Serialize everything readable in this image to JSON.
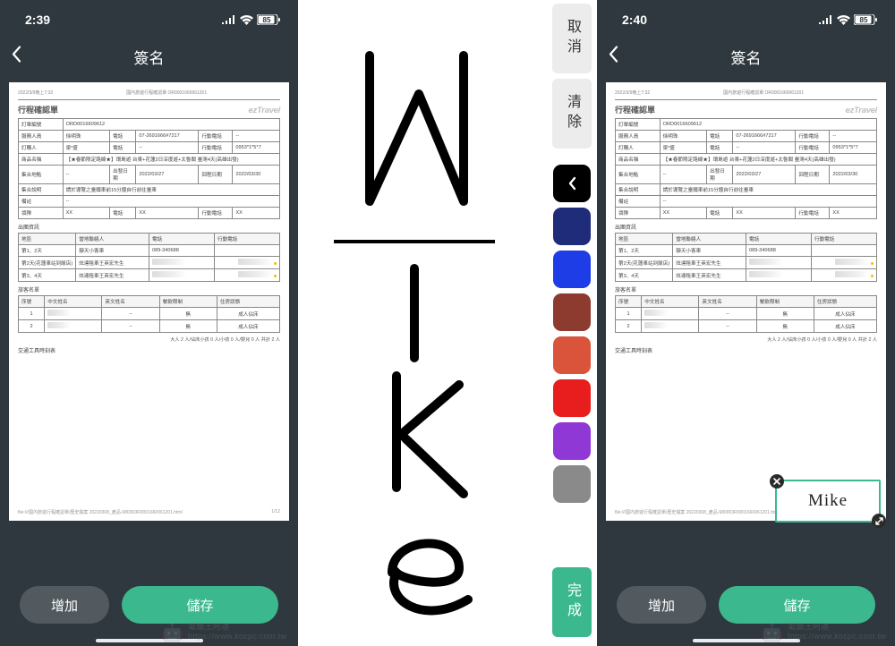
{
  "status": {
    "time1": "2:39",
    "time2": "2:40",
    "battery": "85"
  },
  "nav": {
    "title": "簽名"
  },
  "buttons": {
    "add": "增加",
    "save": "儲存",
    "cancel": "取消",
    "clear": "清除",
    "done": "完成"
  },
  "colors": {
    "black": "#000000",
    "navy": "#1f2c7a",
    "blue": "#1f3de6",
    "brown": "#8c3b2e",
    "orange": "#d9543b",
    "red": "#e81e1e",
    "purple": "#9038d6",
    "gray": "#8a8a8a"
  },
  "signature_text": "Mike",
  "doc": {
    "timestamp_top": "2022/3/9晚上7:32",
    "header_center": "國內旅遊行程確認單 OR0001660961201",
    "title": "行程確認單",
    "brand": "ezTravel",
    "rows": {
      "order_label": "訂單編號",
      "order_value": "ORD0016609612",
      "contact_label": "服務人員",
      "contact_value": "徐明珠",
      "phone_label": "電話",
      "phone_value": "07-2691666#7217",
      "mobile_label": "行動電話",
      "mobile_value": "--",
      "member_label": "訂購人",
      "member_value": "梁*盛",
      "member_phone": "--",
      "member_mobile": "0953*1*5*7",
      "product_label": "商品名稱",
      "product_value": "【★春節限定路線★】環島遊 台東+花蓮2日深度遊+太魯閣 臺灣4天(高雄出發)",
      "meeting_label": "集合地點",
      "meeting_value": "--",
      "depart_label": "出發日期",
      "depart_value": "2022/03/27",
      "return_label": "回程日期",
      "return_value": "2022/03/30",
      "gather_label": "集合說明",
      "gather_value": "請於導覽之臺鐵車前15分鐘自行前往臺車",
      "note_label": "備註",
      "note_value": "--",
      "leader_label": "領隊",
      "leader_value": "XX",
      "leader_phone": "XX",
      "leader_mobile": "XX"
    },
    "section_trip": "出團資訊",
    "trip_headers": {
      "area": "地區",
      "local": "當地聯絡人",
      "phone": "電話",
      "mobile": "行動電話"
    },
    "trip_rows": [
      {
        "area": "第1、2天",
        "local": "靜天小客車",
        "phone": "089-340688",
        "mobile": ""
      },
      {
        "area": "第2天(花蓮車站到飯店)",
        "local": "炫達租車王英宏先生",
        "phone": "",
        "mobile": ""
      },
      {
        "area": "第3、4天",
        "local": "炫達租車王英宏先生",
        "phone": "",
        "mobile": ""
      }
    ],
    "section_pax": "旅客名單",
    "pax_headers": {
      "seq": "序號",
      "cname": "中文姓名",
      "ename": "英文姓名",
      "meal": "餐飲限制",
      "room": "住房狀態"
    },
    "pax_rows": [
      {
        "seq": "1",
        "cname": "",
        "ename": "--",
        "meal": "無",
        "room": "成人佔床"
      },
      {
        "seq": "2",
        "cname": "",
        "ename": "--",
        "meal": "無",
        "room": "成人佔床"
      }
    ],
    "pax_summary": "大人 2 人/佔床小孩 0 人/小孩 0 人/嬰兒 0 人 共計 2 人",
    "section_traffic": "交通工具時刻表",
    "footer_left": "file:///國內旅遊行程確認單/歷史檔案 20220308_產品-980003R0001660961201.html",
    "footer_right": "1/12"
  },
  "watermark": {
    "site": "https://www.kocpc.com.tw",
    "label": "電腦王阿達"
  }
}
